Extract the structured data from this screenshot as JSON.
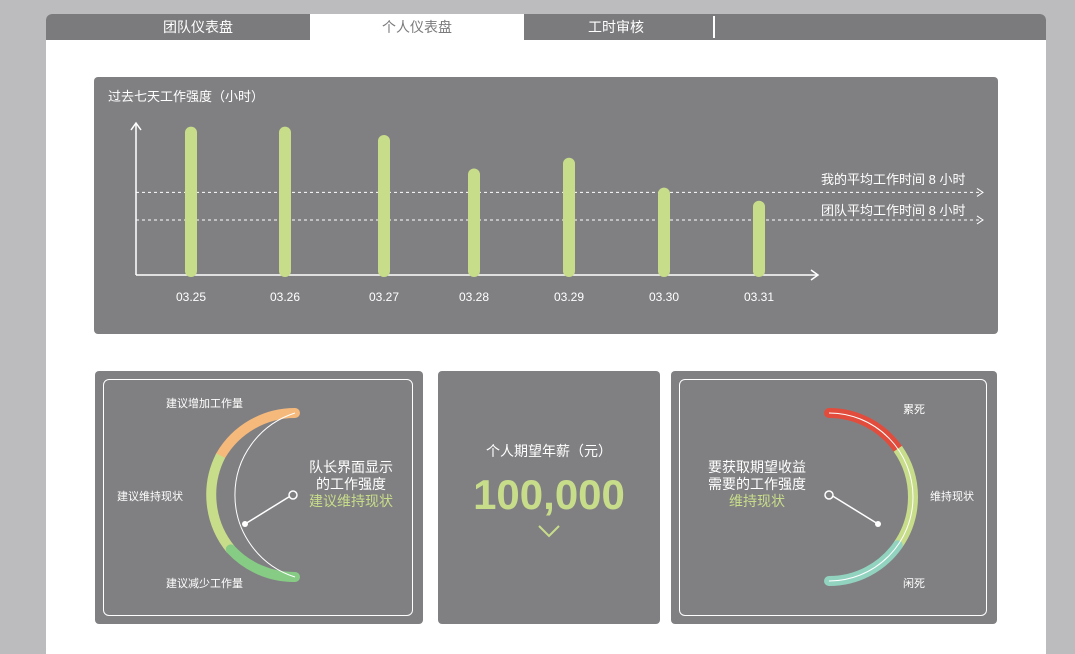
{
  "tabs": [
    {
      "label": "团队仪表盘",
      "active": false
    },
    {
      "label": "个人仪表盘",
      "active": true
    },
    {
      "label": "工时审核",
      "active": false
    }
  ],
  "weekly_card": {
    "title": "过去七天工作强度（小时）",
    "my_avg_label": "我的平均工作时间 8 小时",
    "team_avg_label": "团队平均工作时间 8 小时"
  },
  "chart_data": {
    "type": "bar",
    "title": "过去七天工作强度（小时）",
    "categories": [
      "03.25",
      "03.26",
      "03.27",
      "03.28",
      "03.29",
      "03.30",
      "03.31"
    ],
    "values": [
      12.4,
      12.4,
      11.7,
      8.9,
      9.8,
      7.3,
      6.2
    ],
    "ylim": [
      0,
      13.2
    ],
    "reference_lines": [
      {
        "label": "我的平均工作时间 8 小时",
        "value": 6.9
      },
      {
        "label": "团队平均工作时间 8 小时",
        "value": 4.6
      }
    ],
    "bar_color": "#c8dd8a"
  },
  "left_gauge": {
    "label_top": "建议增加工作量",
    "label_middle": "建议维持现状",
    "label_bottom": "建议减少工作量",
    "center_line1": "队长界面显示",
    "center_line2": "的工作强度",
    "center_status": "建议维持现状",
    "colors": {
      "top": "#f5b97c",
      "middle": "#c8dd8a",
      "bottom": "#86cc84"
    }
  },
  "salary_card": {
    "title": "个人期望年薪（元）",
    "value": "100,000",
    "chevron_icon": "chevron-down-icon"
  },
  "right_gauge": {
    "label_top": "累死",
    "label_middle": "维持现状",
    "label_bottom": "闲死",
    "center_line1": "要获取期望收益",
    "center_line2": "需要的工作强度",
    "center_status": "维持现状",
    "colors": {
      "top": "#e24c3c",
      "middle": "#c8dd8a",
      "bottom": "#92d3c0"
    }
  }
}
